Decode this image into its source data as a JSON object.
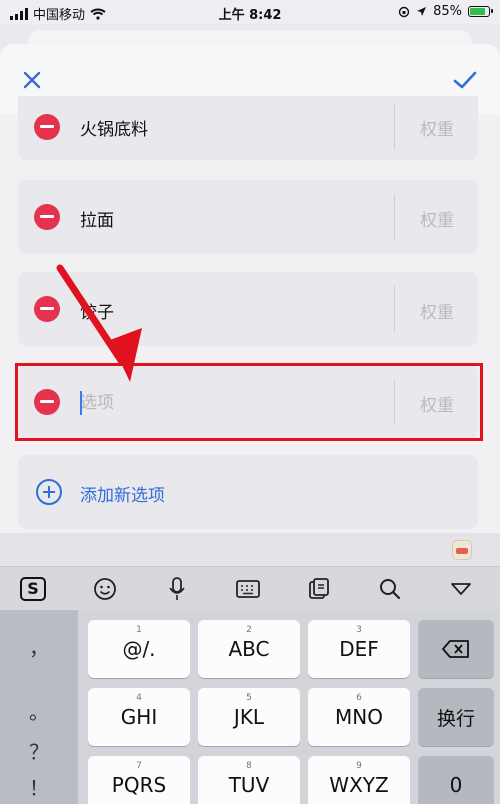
{
  "status_bar": {
    "carrier": "中国移动",
    "time": "上午 8:42",
    "battery": "85%"
  },
  "nav": {
    "close_icon": "close-icon",
    "confirm_icon": "checkmark-icon"
  },
  "options": [
    {
      "value": "火锅底料",
      "weight_placeholder": "权重"
    },
    {
      "value": "拉面",
      "weight_placeholder": "权重"
    },
    {
      "value": "饺子",
      "weight_placeholder": "权重"
    },
    {
      "value": "",
      "placeholder": "选项",
      "weight_placeholder": "权重"
    }
  ],
  "add_option": {
    "label": "添加新选项"
  },
  "keyboard": {
    "toolbar": [
      "sogou-logo-icon",
      "emoji-icon",
      "microphone-icon",
      "keyboard-icon",
      "clipboard-icon",
      "search-icon",
      "collapse-icon"
    ],
    "toolbar_logo_text": "S",
    "side_keys": [
      "，",
      "。",
      "？",
      "！"
    ],
    "rows": [
      {
        "keys": [
          {
            "label": "@/.",
            "num": "1"
          },
          {
            "label": "ABC",
            "num": "2"
          },
          {
            "label": "DEF",
            "num": "3"
          }
        ],
        "right": "⌫"
      },
      {
        "keys": [
          {
            "label": "GHI",
            "num": "4"
          },
          {
            "label": "JKL",
            "num": "5"
          },
          {
            "label": "MNO",
            "num": "6"
          }
        ],
        "right": "换行"
      },
      {
        "keys": [
          {
            "label": "PQRS",
            "num": "7"
          },
          {
            "label": "TUV",
            "num": "8"
          },
          {
            "label": "WXYZ",
            "num": "9"
          }
        ],
        "right": "0"
      }
    ]
  },
  "colors": {
    "accent": "#2f6fd6",
    "delete": "#e5334d",
    "annotation": "#e1121f"
  }
}
